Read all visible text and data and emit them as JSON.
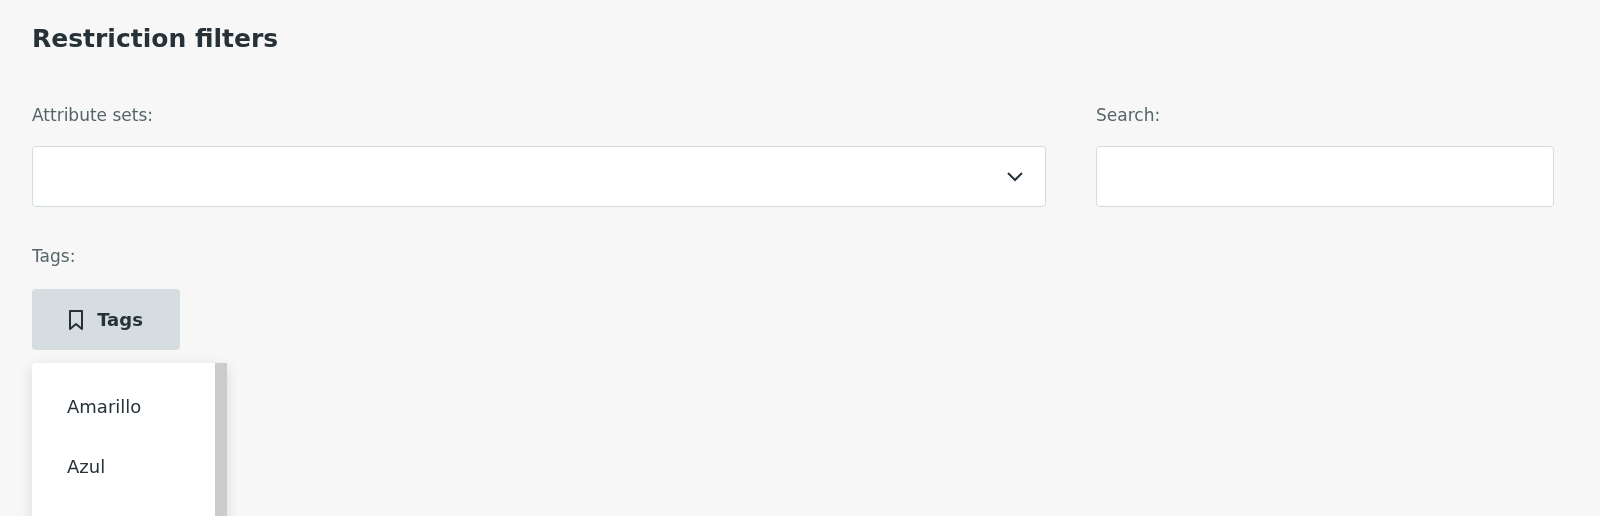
{
  "title": "Restriction filters",
  "attribute_sets": {
    "label": "Attribute sets:"
  },
  "search": {
    "label": "Search:"
  },
  "tags": {
    "label": "Tags:",
    "button": "Tags",
    "expanded": true,
    "options": [
      "Amarillo",
      "Azul"
    ]
  }
}
